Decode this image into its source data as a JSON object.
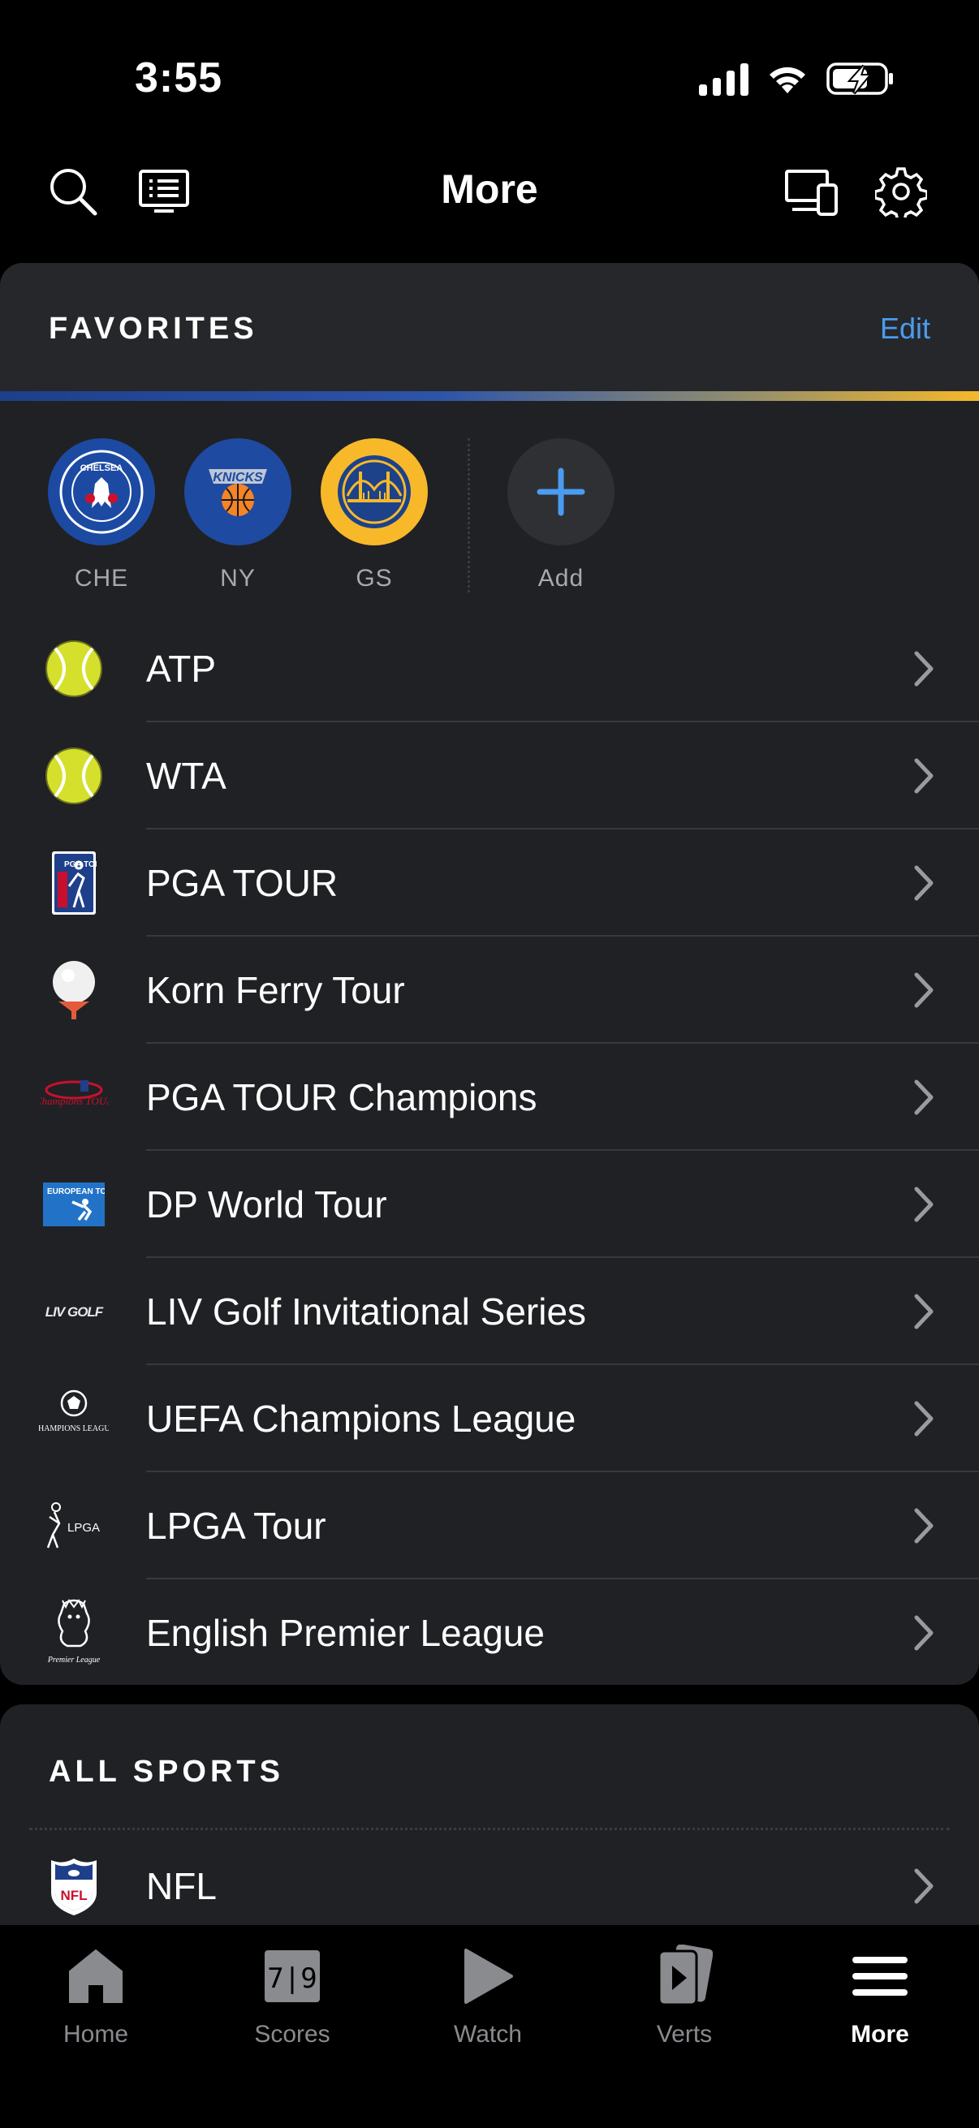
{
  "status_bar": {
    "time": "3:55"
  },
  "header": {
    "title": "More"
  },
  "favorites": {
    "section_title": "FAVORITES",
    "edit_label": "Edit",
    "teams": [
      {
        "abbr": "CHE",
        "color": "#1c4aa3",
        "icon": "chelsea-crest-icon"
      },
      {
        "abbr": "NY",
        "color": "#1f4aa1",
        "icon": "knicks-logo-icon"
      },
      {
        "abbr": "GS",
        "color": "#f7b92a",
        "icon": "warriors-logo-icon"
      }
    ],
    "add_label": "Add",
    "leagues": [
      {
        "name": "ATP",
        "icon": "tennis-ball-icon"
      },
      {
        "name": "WTA",
        "icon": "tennis-ball-icon"
      },
      {
        "name": "PGA TOUR",
        "icon": "pga-tour-logo-icon"
      },
      {
        "name": "Korn Ferry Tour",
        "icon": "golf-ball-tee-icon"
      },
      {
        "name": "PGA TOUR Champions",
        "icon": "pga-champions-logo-icon"
      },
      {
        "name": "DP World Tour",
        "icon": "dp-world-tour-logo-icon"
      },
      {
        "name": "LIV Golf Invitational Series",
        "icon": "liv-golf-logo-icon"
      },
      {
        "name": "UEFA Champions League",
        "icon": "champions-league-logo-icon"
      },
      {
        "name": "LPGA Tour",
        "icon": "lpga-logo-icon"
      },
      {
        "name": "English Premier League",
        "icon": "premier-league-logo-icon"
      }
    ]
  },
  "all_sports": {
    "section_title": "ALL SPORTS",
    "items": [
      {
        "name": "NFL",
        "icon": "nfl-logo-icon"
      }
    ]
  },
  "logo_text": {
    "chelsea": "CHELSEA",
    "pga": "PGA TOUR",
    "champions": "Champions TOUR",
    "dp_world": "EUROPEAN TOUR",
    "liv": "LIV GOLF",
    "ucl": "CHAMPIONS LEAGUE",
    "lpga": "LPGA",
    "epl": "Premier League",
    "nfl": "NFL"
  },
  "tabs": [
    {
      "label": "Home",
      "icon": "home-icon",
      "active": false
    },
    {
      "label": "Scores",
      "icon": "scores-icon",
      "score_text": "7|9",
      "active": false
    },
    {
      "label": "Watch",
      "icon": "play-icon",
      "active": false
    },
    {
      "label": "Verts",
      "icon": "verts-icon",
      "active": false
    },
    {
      "label": "More",
      "icon": "hamburger-menu-icon",
      "active": true
    }
  ],
  "colors": {
    "background": "#000000",
    "card": "#202124",
    "accent_blue": "#4a9cf0",
    "gold": "#f6b82a"
  }
}
